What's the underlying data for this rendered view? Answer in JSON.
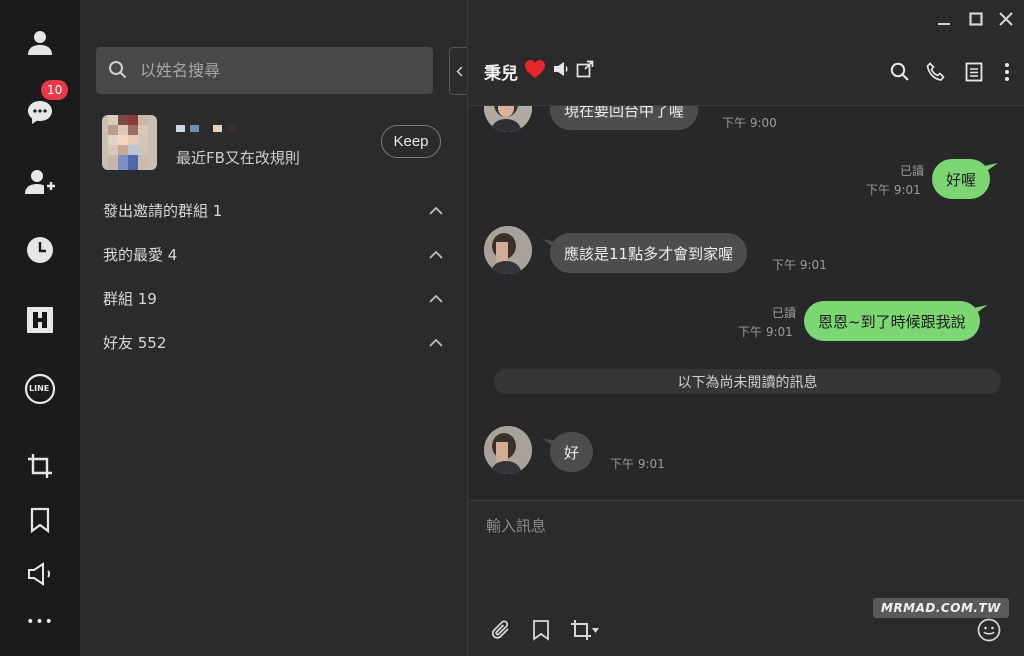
{
  "rail": {
    "items": [
      {
        "icon": "person-icon"
      },
      {
        "icon": "chat-icon",
        "badge": "10"
      },
      {
        "icon": "add-friend-icon"
      },
      {
        "icon": "clock-icon"
      },
      {
        "icon": "h-app-icon"
      },
      {
        "icon": "line-icon",
        "label": "LINE"
      },
      {
        "icon": "crop-icon"
      },
      {
        "icon": "bookmark-icon"
      },
      {
        "icon": "speaker-icon"
      },
      {
        "icon": "more-icon",
        "label": "•••"
      }
    ]
  },
  "list": {
    "search_placeholder": "以姓名搜尋",
    "profile": {
      "status": "最近FB又在改規則",
      "keep_label": "Keep"
    },
    "groups": [
      {
        "label": "發出邀請的群組 1"
      },
      {
        "label": "我的最愛 4"
      },
      {
        "label": "群組 19"
      },
      {
        "label": "好友 552"
      }
    ]
  },
  "chat": {
    "title": "秉兒",
    "heart": "❤️",
    "messages": [
      {
        "dir": "in",
        "text": "現在要回台中了喔",
        "time": "下午 9:00"
      },
      {
        "dir": "out",
        "text": "好喔",
        "time": "下午 9:01",
        "read": "已讀"
      },
      {
        "dir": "in",
        "text": "應該是11點多才會到家喔",
        "time": "下午 9:01"
      },
      {
        "dir": "out",
        "text": "恩恩~到了時候跟我說",
        "time": "下午 9:01",
        "read": "已讀"
      },
      {
        "dir": "in",
        "text": "好",
        "time": "下午 9:01"
      }
    ],
    "unread_divider": "以下為尚未閱讀的訊息",
    "input_placeholder": "輸入訊息",
    "watermark": "MRMAD.COM.TW"
  },
  "colors": {
    "accent_green": "#7cd672",
    "badge_red": "#e8394a"
  }
}
